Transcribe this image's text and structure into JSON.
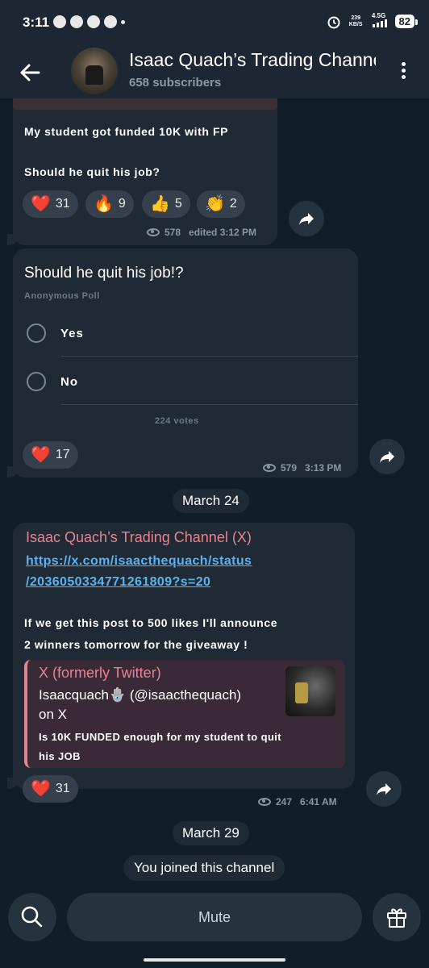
{
  "status_bar": {
    "time": "3:11",
    "net_speed": "239",
    "net_unit": "KB/S",
    "network": "4.5G",
    "battery": "82"
  },
  "header": {
    "title": "Isaac Quach’s Trading Channel",
    "subscribers": "658 subscribers"
  },
  "messages": [
    {
      "line1": "My student got funded 10K with FP",
      "line2": "Should he quit his job?",
      "reactions": [
        {
          "emoji": "❤️",
          "count": "31"
        },
        {
          "emoji": "🔥",
          "count": "9"
        },
        {
          "emoji": "👍",
          "count": "5"
        },
        {
          "emoji": "👏",
          "count": "2"
        }
      ],
      "views": "578",
      "time": "edited 3:12 PM"
    },
    {
      "question": "Should he quit his job!?",
      "poll_type": "Anonymous Poll",
      "options": [
        "Yes",
        "No"
      ],
      "votes": "224 votes",
      "reaction": {
        "emoji": "❤️",
        "count": "17"
      },
      "views": "579",
      "time": "3:13 PM"
    },
    {
      "date": "March 24",
      "link_title": "Isaac Quach’s Trading Channel (X)",
      "url_line1": "https://x.com/isaacthequach/status",
      "url_line2": "/2036050334771261809?s=20",
      "body_line1": "If we get this post to 500 likes I'll announce",
      "body_line2": "2 winners tomorrow for the giveaway !",
      "preview": {
        "site": "X (formerly Twitter)",
        "author": "Isaacquach🪬 (@isaacthequach)",
        "on": "on X",
        "desc_line1": "Is 10K FUNDED enough for my student to quit",
        "desc_line2": "his JOB"
      },
      "reaction": {
        "emoji": "❤️",
        "count": "31"
      },
      "views": "247",
      "time": "6:41 AM"
    }
  ],
  "date2": "March 29",
  "joined": "You joined this channel",
  "bottom": {
    "mute_label": "Mute"
  },
  "colors": {
    "accent_link": "#5ab3f0",
    "accent_pink": "#e5848f",
    "bubble": "#1f2a35",
    "background": "#111d27"
  },
  "icons": [
    "back-arrow-icon",
    "more-vert-icon",
    "eye-icon",
    "share-icon",
    "search-icon",
    "gift-icon"
  ]
}
